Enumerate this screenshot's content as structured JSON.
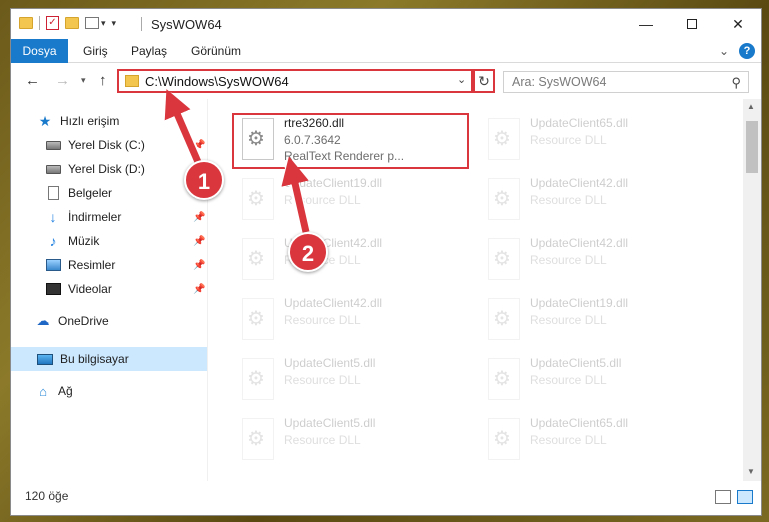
{
  "window": {
    "title": "SysWOW64"
  },
  "ribbon": {
    "tabs": [
      "Dosya",
      "Giriş",
      "Paylaş",
      "Görünüm"
    ],
    "help": "?"
  },
  "nav": {
    "address": "C:\\Windows\\SysWOW64",
    "search_placeholder": "Ara: SysWOW64"
  },
  "sidebar": {
    "items": [
      {
        "label": "Hızlı erişim",
        "icon": "star-icon",
        "pinned": false
      },
      {
        "label": "Yerel Disk (C:)",
        "icon": "drive-icon",
        "pinned": true
      },
      {
        "label": "Yerel Disk (D:)",
        "icon": "drive-icon",
        "pinned": false
      },
      {
        "label": "Belgeler",
        "icon": "document-icon",
        "pinned": true
      },
      {
        "label": "İndirmeler",
        "icon": "download-icon",
        "pinned": true
      },
      {
        "label": "Müzik",
        "icon": "music-icon",
        "pinned": true
      },
      {
        "label": "Resimler",
        "icon": "pictures-icon",
        "pinned": true
      },
      {
        "label": "Videolar",
        "icon": "videos-icon",
        "pinned": true
      },
      {
        "label": "OneDrive",
        "icon": "cloud-icon",
        "pinned": false
      },
      {
        "label": "Bu bilgisayar",
        "icon": "computer-icon",
        "pinned": false,
        "selected": true
      },
      {
        "label": "Ağ",
        "icon": "network-icon",
        "pinned": false
      }
    ]
  },
  "files": [
    {
      "name": "rtre3260.dll",
      "line2": "6.0.7.3642",
      "line3": "RealText Renderer p...",
      "highlighted": true
    },
    {
      "name": "UpdateClient65.dll",
      "line2": "Resource DLL",
      "faded": true
    },
    {
      "name": "UpdateClient19.dll",
      "line2": "Resource DLL",
      "faded": true
    },
    {
      "name": "UpdateClient42.dll",
      "line2": "Resource DLL",
      "faded": true
    },
    {
      "name": "UpdateClient42.dll",
      "line2": "Resource DLL",
      "faded": true
    },
    {
      "name": "UpdateClient42.dll",
      "line2": "Resource DLL",
      "faded": true
    },
    {
      "name": "UpdateClient42.dll",
      "line2": "Resource DLL",
      "faded": true
    },
    {
      "name": "UpdateClient19.dll",
      "line2": "Resource DLL",
      "faded": true
    },
    {
      "name": "UpdateClient5.dll",
      "line2": "Resource DLL",
      "faded": true
    },
    {
      "name": "UpdateClient5.dll",
      "line2": "Resource DLL",
      "faded": true
    },
    {
      "name": "UpdateClient5.dll",
      "line2": "Resource DLL",
      "faded": true
    },
    {
      "name": "UpdateClient65.dll",
      "line2": "Resource DLL",
      "faded": true
    }
  ],
  "status": {
    "item_count": "120 öğe"
  },
  "annotations": {
    "label_1": "1",
    "label_2": "2",
    "color": "#d9363e"
  },
  "colors": {
    "accent": "#1979ca",
    "highlight": "#d9363e",
    "selected_bg": "#cce8ff"
  }
}
